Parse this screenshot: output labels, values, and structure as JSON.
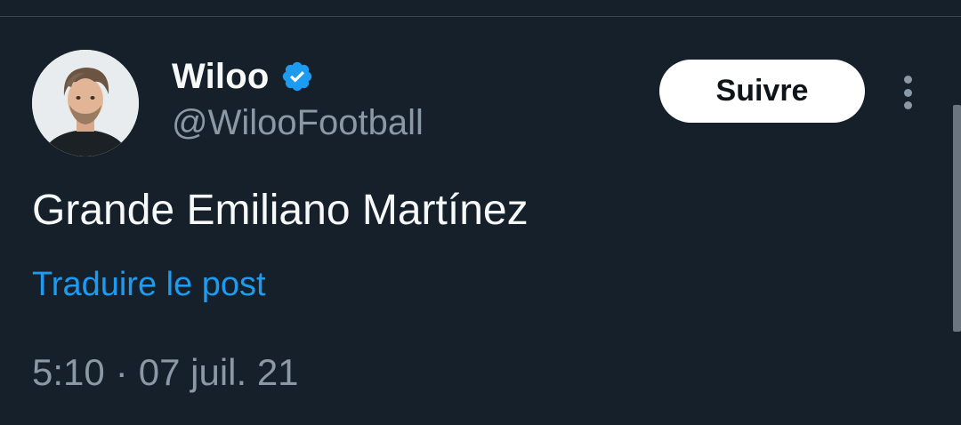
{
  "author": {
    "display_name": "Wiloo",
    "handle": "@WilooFootball",
    "verified": true
  },
  "actions": {
    "follow_label": "Suivre"
  },
  "tweet": {
    "text": "Grande Emiliano Martínez",
    "translate_label": "Traduire le post",
    "time": "5:10",
    "separator": "·",
    "date": "07 juil. 21"
  },
  "icons": {
    "verified": "verified-badge-icon",
    "more": "more-options-icon"
  },
  "colors": {
    "background": "#15202b",
    "primary_text": "#f7f9f9",
    "secondary_text": "#8b98a5",
    "accent": "#1d9bf0",
    "verified_badge": "#1d9bf0",
    "button_bg": "#ffffff"
  }
}
